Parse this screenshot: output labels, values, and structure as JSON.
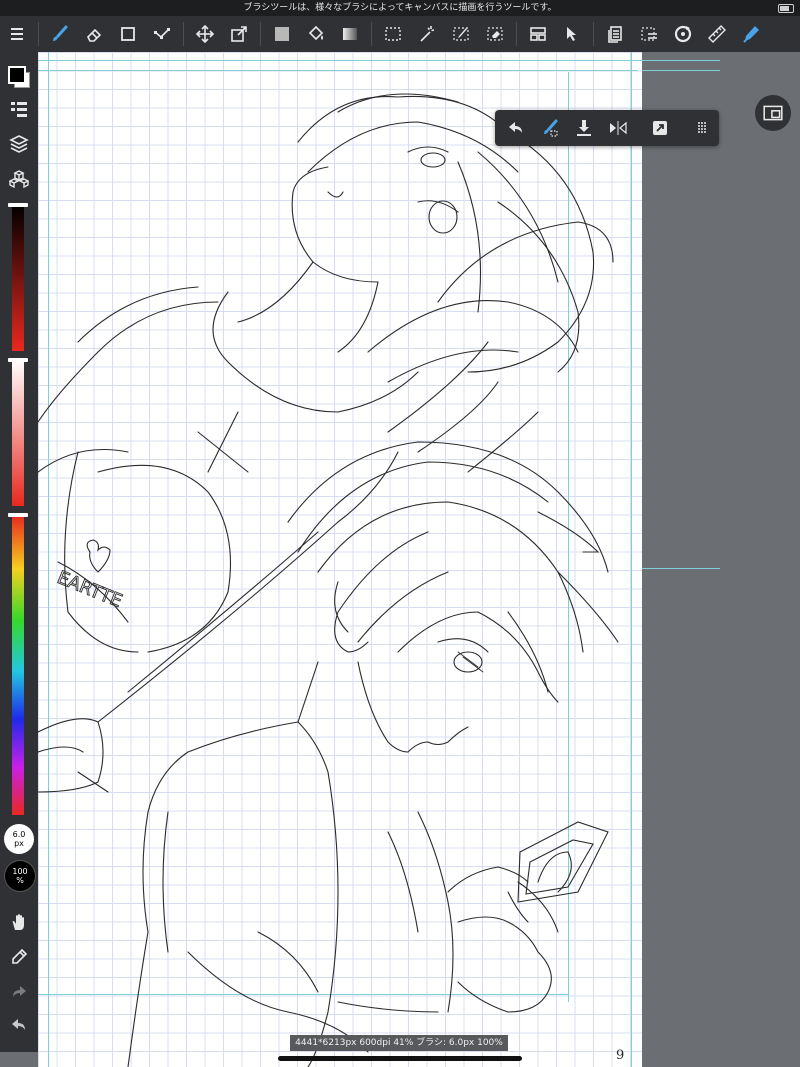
{
  "status_bar": {
    "message": "ブラシツールは、様々なブラシによってキャンバスに描画を行うツールです。"
  },
  "toolbar": {
    "tools": [
      {
        "name": "menu-icon"
      },
      {
        "name": "brush-icon",
        "active": true
      },
      {
        "name": "eraser-icon"
      },
      {
        "name": "shape-icon"
      },
      {
        "name": "vector-icon"
      },
      {
        "name": "move-icon"
      },
      {
        "name": "transform-icon"
      },
      {
        "name": "fill-rect-icon"
      },
      {
        "name": "bucket-icon"
      },
      {
        "name": "gradient-icon"
      },
      {
        "name": "select-icon"
      },
      {
        "name": "magic-wand-icon"
      },
      {
        "name": "select-pen-icon"
      },
      {
        "name": "select-eraser-icon"
      },
      {
        "name": "text-icon"
      },
      {
        "name": "operation-icon"
      },
      {
        "name": "panel-icon"
      },
      {
        "name": "selection-layer-icon"
      },
      {
        "name": "rotate-icon"
      },
      {
        "name": "ruler-icon"
      },
      {
        "name": "eyedropper-icon"
      }
    ]
  },
  "sidebar": {
    "brush_size": {
      "value": "6.0",
      "unit": "px"
    },
    "opacity": {
      "value": "100",
      "unit": "%"
    }
  },
  "info_bar": {
    "text": "4441*6213px 600dpi 41% ブラシ: 6.0px 100%"
  },
  "canvas": {
    "page_number": "9",
    "shirt_text": "EARTTE"
  },
  "colors": {
    "toolbar_bg": "#2f3134",
    "accent": "#4aa3e8",
    "workspace_bg": "#6b6e72",
    "grid": "#d8dcf2",
    "guide": "#7fd0d8"
  }
}
